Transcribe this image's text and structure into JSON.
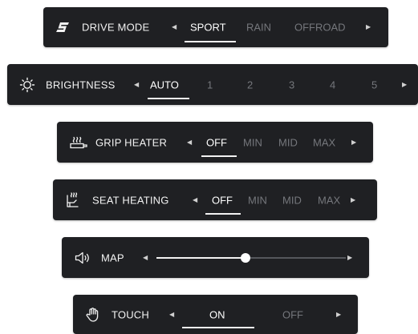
{
  "drive_mode": {
    "label": "DRIVE MODE",
    "icon": "s-logo-icon",
    "options": [
      "SPORT",
      "RAIN",
      "OFFROAD"
    ],
    "selected": "SPORT"
  },
  "brightness": {
    "label": "BRIGHTNESS",
    "icon": "brightness-icon",
    "options": [
      "AUTO",
      "1",
      "2",
      "3",
      "4",
      "5"
    ],
    "selected": "AUTO"
  },
  "grip_heater": {
    "label": "GRIP HEATER",
    "icon": "grip-heater-icon",
    "options": [
      "OFF",
      "MIN",
      "MID",
      "MAX"
    ],
    "selected": "OFF"
  },
  "seat_heating": {
    "label": "SEAT HEATING",
    "icon": "seat-heating-icon",
    "options": [
      "OFF",
      "MIN",
      "MID",
      "MAX"
    ],
    "selected": "OFF"
  },
  "map": {
    "label": "MAP",
    "icon": "speaker-icon",
    "slider_value_fraction": 0.47
  },
  "touch": {
    "label": "TOUCH",
    "icon": "hand-touch-icon",
    "options": [
      "ON",
      "OFF"
    ],
    "selected": "ON"
  },
  "colors": {
    "panel_background": "#1f2023",
    "selected_text": "#ffffff",
    "unselected_text": "#75777c",
    "page_background": "#ffffff"
  }
}
